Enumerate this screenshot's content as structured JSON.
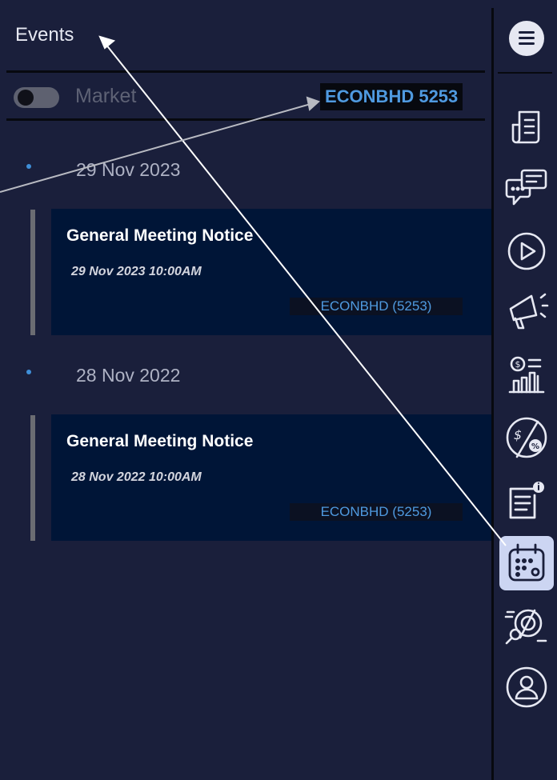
{
  "header": {
    "title": "Events"
  },
  "filter": {
    "toggle_label": "Market",
    "stock_badge": "ECONBHD 5253"
  },
  "events": [
    {
      "date_header": "29 Nov 2023",
      "title": "General Meeting Notice",
      "datetime": "29 Nov 2023  10:00AM",
      "stock": "ECONBHD (5253)"
    },
    {
      "date_header": "28 Nov 2022",
      "title": "General Meeting Notice",
      "datetime": "28 Nov 2022  10:00AM",
      "stock": "ECONBHD (5253)"
    }
  ],
  "sidebar": {
    "menu_icon": "hamburger-menu-icon",
    "items": [
      {
        "icon": "document-icon",
        "active": false
      },
      {
        "icon": "chat-bubbles-icon",
        "active": false
      },
      {
        "icon": "play-icon",
        "active": false
      },
      {
        "icon": "megaphone-icon",
        "active": false
      },
      {
        "icon": "dividend-chart-icon",
        "active": false
      },
      {
        "icon": "price-percent-icon",
        "active": false
      },
      {
        "icon": "report-info-icon",
        "active": false
      },
      {
        "icon": "calendar-icon",
        "active": true
      },
      {
        "icon": "search-analytics-icon",
        "active": false
      },
      {
        "icon": "profile-icon",
        "active": false
      }
    ]
  },
  "colors": {
    "background": "#1a1f3b",
    "card": "#001537",
    "accent": "#4f9ae0",
    "active_icon_bg": "#ccd5f2"
  }
}
